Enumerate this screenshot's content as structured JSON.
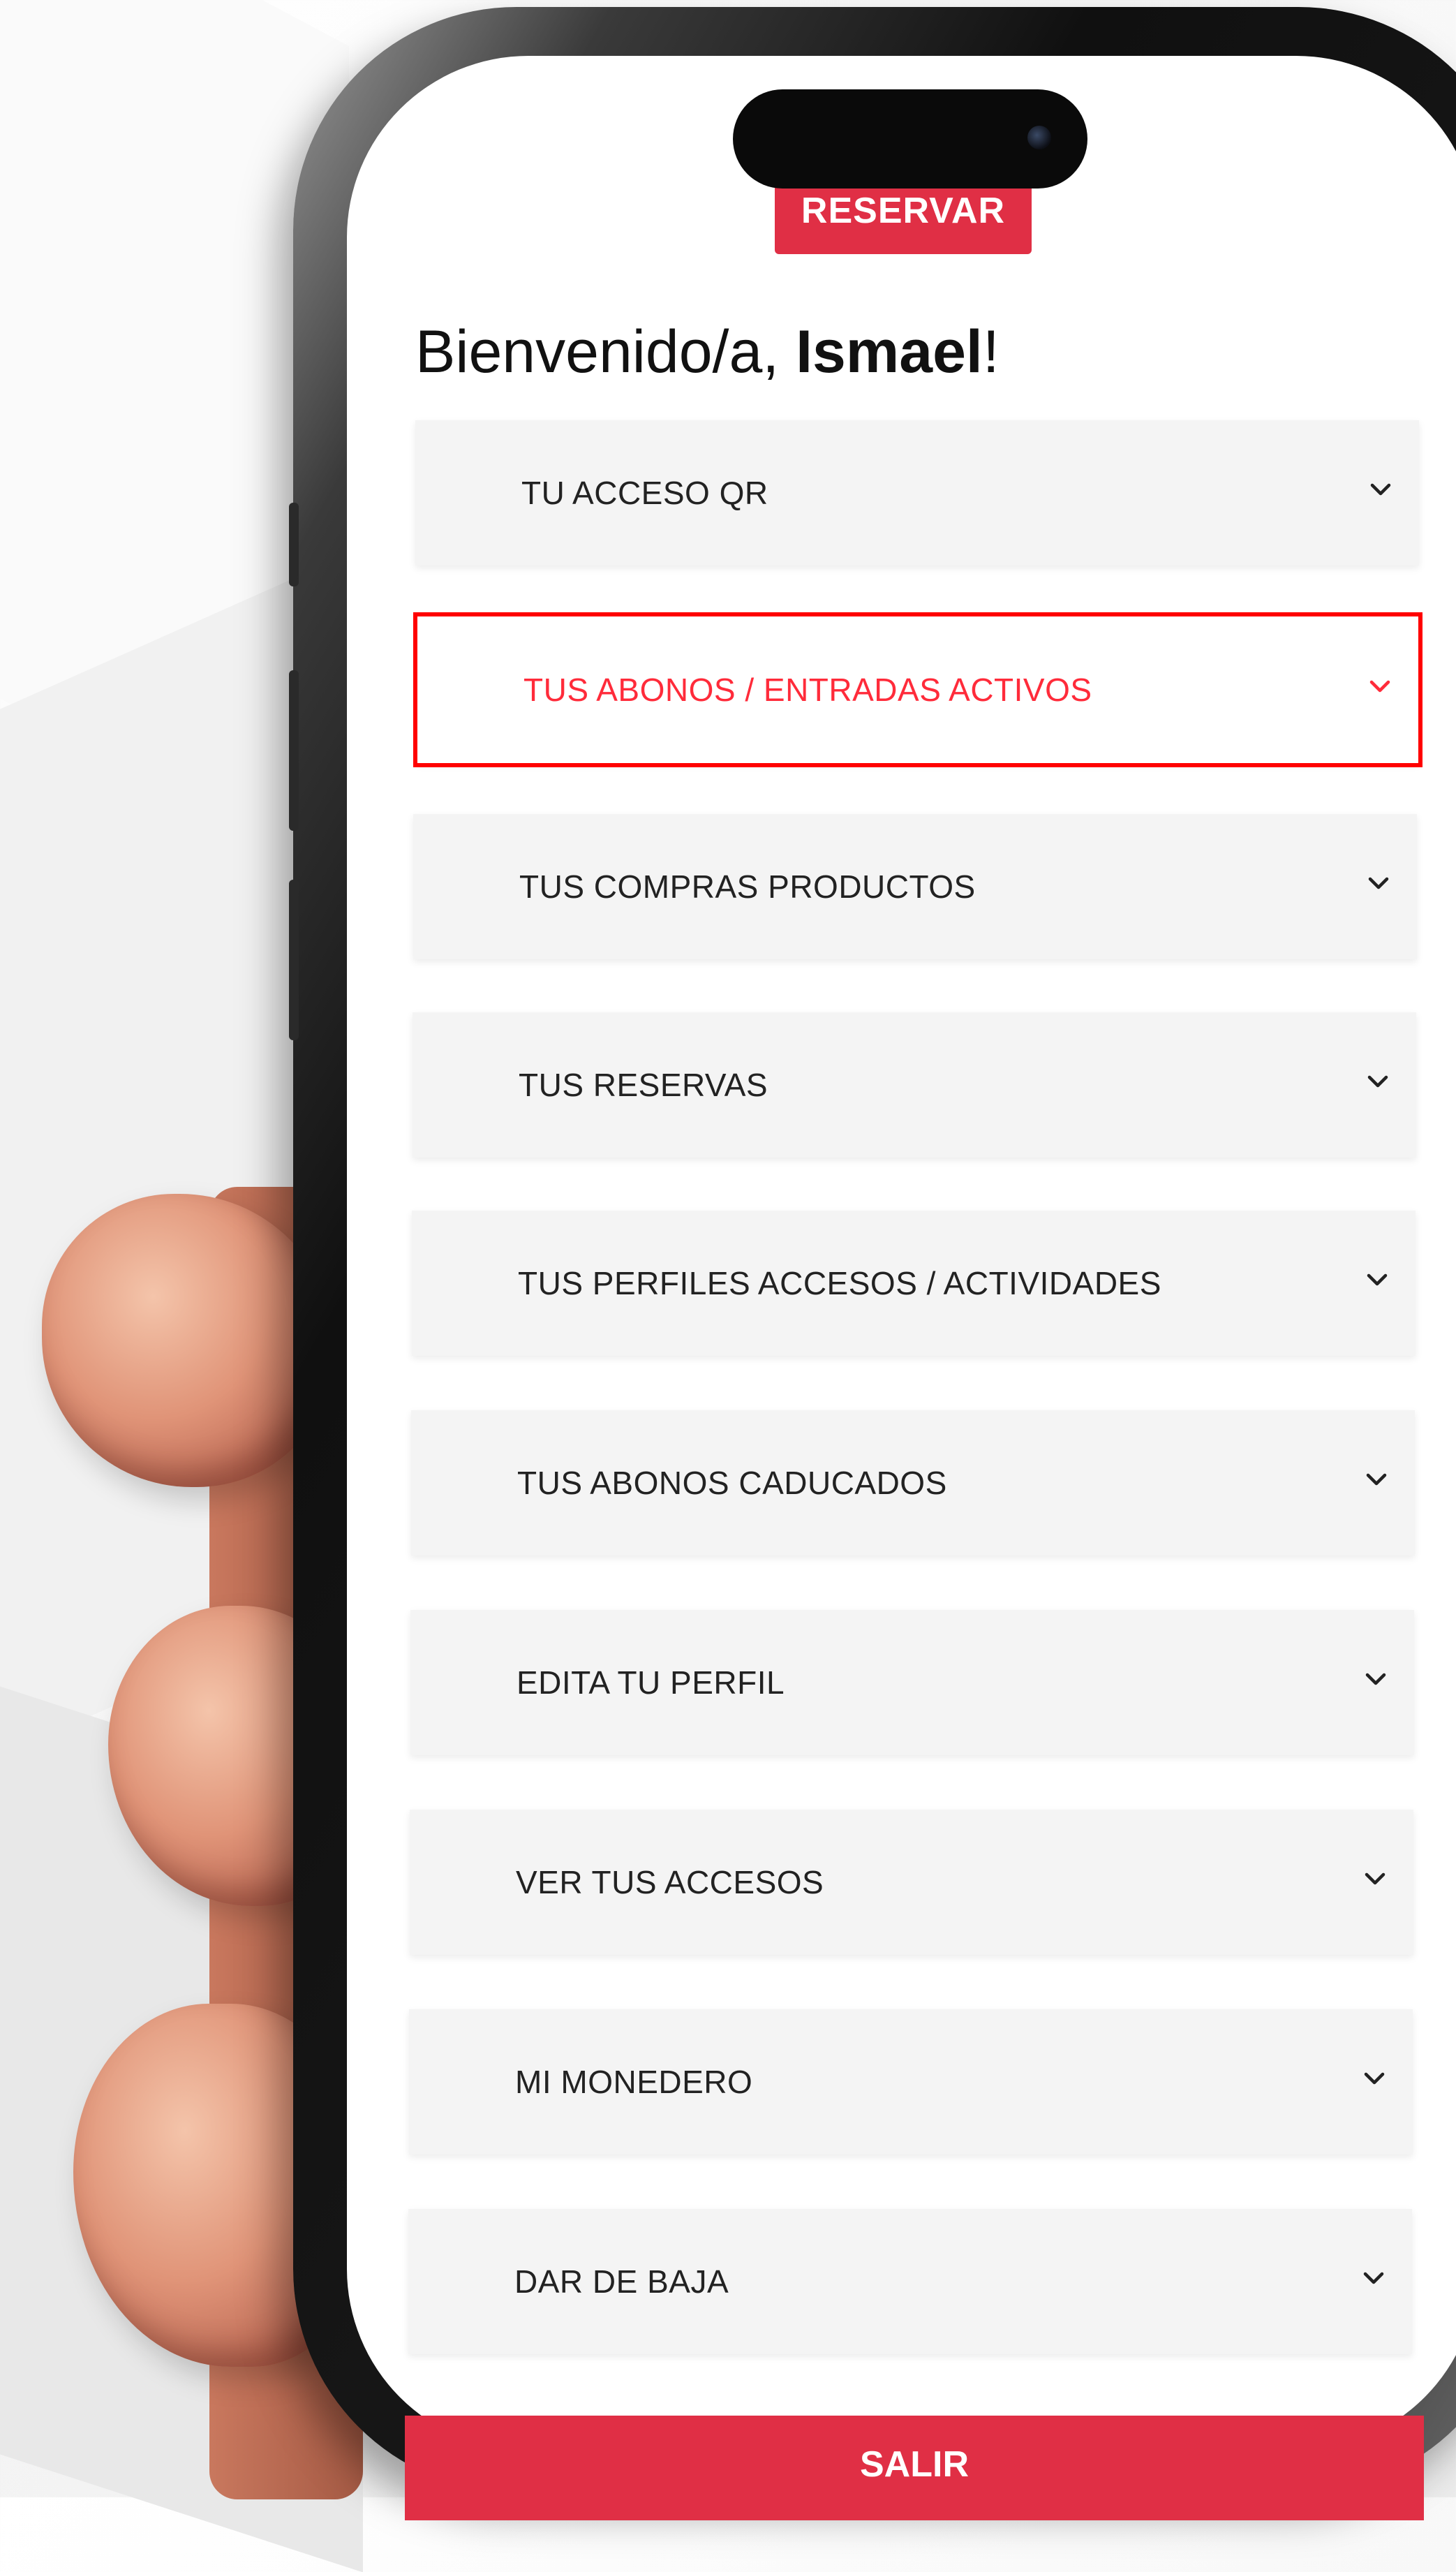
{
  "header": {
    "reserve_button": "RESERVAR"
  },
  "welcome": {
    "prefix": "Bienvenido/a, ",
    "name": "Ismael",
    "suffix": "!"
  },
  "menu": {
    "items": [
      {
        "label": "TU ACCESO QR"
      },
      {
        "label": "TUS ABONOS / ENTRADAS ACTIVOS",
        "highlighted": true
      },
      {
        "label": "TUS COMPRAS PRODUCTOS"
      },
      {
        "label": "TUS RESERVAS"
      },
      {
        "label": "TUS PERFILES ACCESOS / ACTIVIDADES"
      },
      {
        "label": "TUS ABONOS CADUCADOS"
      },
      {
        "label": "EDITA TU PERFIL"
      },
      {
        "label": "VER TUS ACCESOS"
      },
      {
        "label": "MI MONEDERO"
      },
      {
        "label": "DAR DE BAJA"
      }
    ]
  },
  "footer": {
    "logout_button": "SALIR"
  },
  "colors": {
    "accent": "#e02f45",
    "highlight": "#ff0000",
    "item_bg": "#f4f4f4"
  },
  "icons": {
    "expand": "chevron-down-icon"
  }
}
